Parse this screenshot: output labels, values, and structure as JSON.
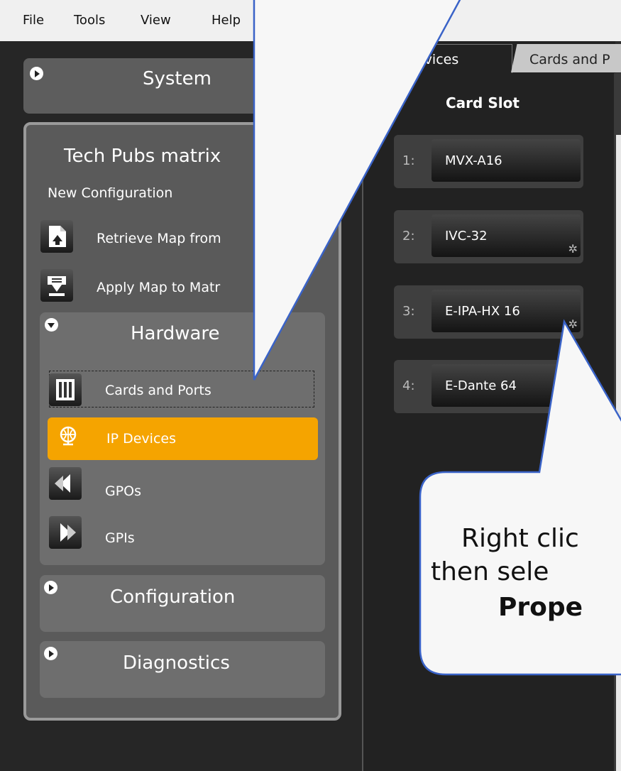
{
  "menu": {
    "file": "File",
    "tools": "Tools",
    "view": "View",
    "help": "Help"
  },
  "tabs": {
    "devices": "evices",
    "cards": "Cards and P"
  },
  "sidebar": {
    "system": "System",
    "matrix_name": "Tech Pubs matrix",
    "new_config": "New Configuration",
    "retrieve": "Retrieve Map from",
    "apply": "Apply Map to Matr",
    "hardware": "Hardware",
    "cards_ports": "Cards and Ports",
    "ip_devices": "IP Devices",
    "gpos": "GPOs",
    "gpis": "GPIs",
    "configuration": "Configuration",
    "diagnostics": "Diagnostics"
  },
  "card_slot": {
    "header": "Card Slot",
    "slots": [
      {
        "num": "1:",
        "name": "MVX-A16"
      },
      {
        "num": "2:",
        "name": "IVC-32"
      },
      {
        "num": "3:",
        "name": "E-IPA-HX 16"
      },
      {
        "num": "4:",
        "name": "E-Dante 64"
      }
    ]
  },
  "callout": {
    "line1": "Right clic",
    "line2": "then sele",
    "line3": "Prope"
  },
  "colors": {
    "accent": "#f5a400",
    "callout_border": "#3a63c8"
  }
}
